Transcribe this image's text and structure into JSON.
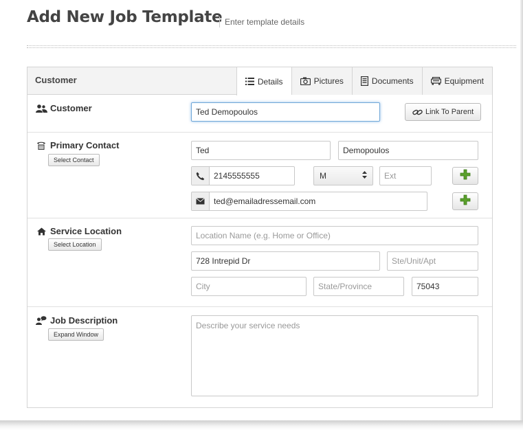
{
  "header": {
    "title": "Add New Job Template",
    "subtitle": "Enter template details"
  },
  "panel": {
    "title": "Customer",
    "tabs": [
      {
        "label": "Details",
        "icon": "list-icon",
        "active": true
      },
      {
        "label": "Pictures",
        "icon": "camera-icon",
        "active": false
      },
      {
        "label": "Documents",
        "icon": "document-icon",
        "active": false
      },
      {
        "label": "Equipment",
        "icon": "equipment-icon",
        "active": false
      }
    ]
  },
  "customer": {
    "label": "Customer",
    "icon": "users-icon",
    "name_value": "Ted  Demopoulos",
    "link_button": "Link To Parent"
  },
  "primary_contact": {
    "label": "Primary Contact",
    "icon": "phone-icon",
    "select_button": "Select Contact",
    "first_name": "Ted",
    "last_name": "Demopoulos",
    "phone": "2145555555",
    "phone_type": "M",
    "ext_placeholder": "Ext",
    "email": "ted@emailadressemail.com"
  },
  "service_location": {
    "label": "Service Location",
    "icon": "home-icon",
    "select_button": "Select Location",
    "location_name_placeholder": "Location Name (e.g. Home or Office)",
    "address": "728 Intrepid Dr",
    "unit_placeholder": "Ste/Unit/Apt",
    "city_placeholder": "City",
    "state_placeholder": "State/Province",
    "zip": "75043"
  },
  "job_description": {
    "label": "Job Description",
    "icon": "comment-user-icon",
    "expand_button": "Expand Window",
    "placeholder": "Describe your service needs"
  },
  "colors": {
    "focus_border": "#6fa7d8",
    "plus_green": "#5aa02c",
    "panel_header_bg": "#f3f3f3"
  }
}
